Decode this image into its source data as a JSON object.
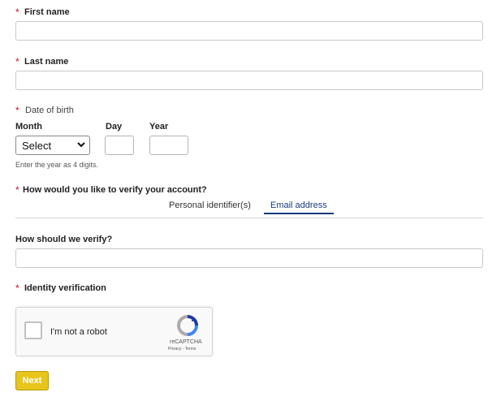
{
  "form": {
    "required_mark": "*",
    "first_name_label": "First name",
    "last_name_label": "Last name",
    "dob_label": "Date of birth",
    "month_label": "Month",
    "day_label": "Day",
    "year_label": "Year",
    "month_value": "Select",
    "year_hint": "Enter the year as 4 digits.",
    "verify_question": "How would you like to verify your account?",
    "verify_tabs": [
      "Personal identifier(s)",
      "Email address"
    ],
    "verify_selected": "Email address",
    "how_verify_label": "How should we verify?",
    "identity_label": "Identity verification"
  },
  "captcha": {
    "text": "I'm not a robot",
    "brand": "reCAPTCHA",
    "links": "Privacy - Terms"
  },
  "actions": {
    "next_label": "Next"
  },
  "colors": {
    "required": "#c8102e",
    "next_button": "#e8c51a",
    "active_tab": "#1a3b7a"
  }
}
